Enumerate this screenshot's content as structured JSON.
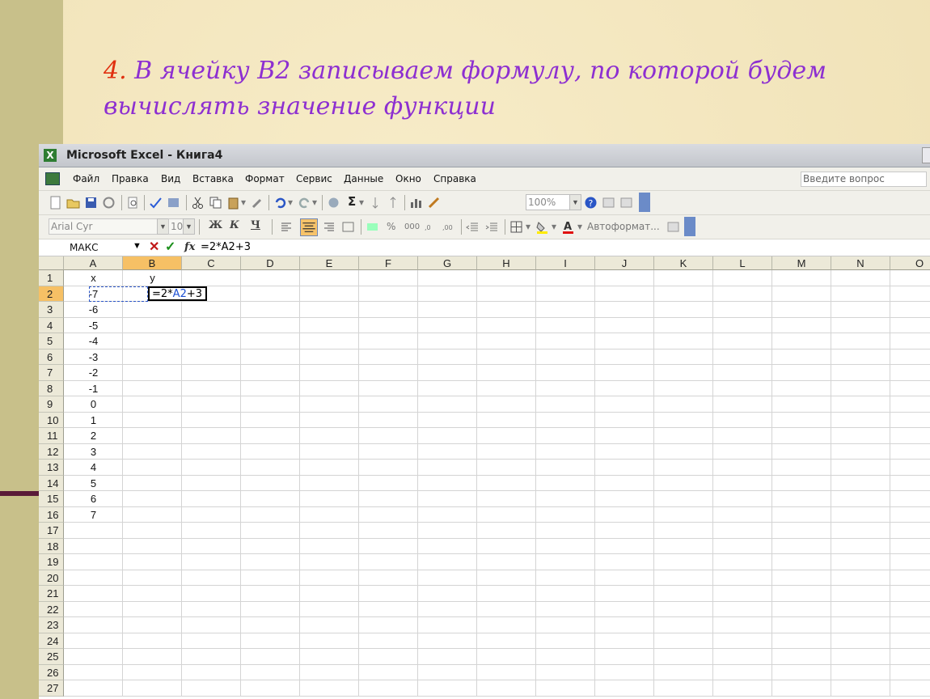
{
  "slide": {
    "step_number": "4.",
    "heading_text": "В ячейку В2 записываем формулу, по которой будем вычислять значение функции"
  },
  "window": {
    "title": "Microsoft Excel - Книга4",
    "icon": "excel-icon"
  },
  "menu": {
    "items": [
      "Файл",
      "Правка",
      "Вид",
      "Вставка",
      "Формат",
      "Сервис",
      "Данные",
      "Окно",
      "Справка"
    ],
    "ask_placeholder": "Введите вопрос"
  },
  "toolbar_standard": {
    "zoom_value": "100%",
    "sigma_label": "Σ"
  },
  "toolbar_format": {
    "font_name": "Arial Cyr",
    "font_size": "10",
    "bold_label": "Ж",
    "italic_label": "К",
    "underline_label": "Ч",
    "percent_label": "%",
    "thousands_label": "000",
    "autoformat_label": "Автоформат..."
  },
  "formula_bar": {
    "name_box": "МАКС",
    "cancel_symbol": "✕",
    "enter_symbol": "✓",
    "fx_label": "fx",
    "formula": "=2*A2+3"
  },
  "sheet": {
    "columns": [
      "A",
      "B",
      "C",
      "D",
      "E",
      "F",
      "G",
      "H",
      "I",
      "J",
      "K",
      "L",
      "M",
      "N",
      "O"
    ],
    "active_column": "B",
    "row_numbers": [
      "1",
      "2",
      "3",
      "4",
      "5",
      "6",
      "7",
      "8",
      "9",
      "10",
      "11",
      "12",
      "13",
      "14",
      "15",
      "16",
      "17",
      "18",
      "19",
      "20",
      "21",
      "22",
      "23",
      "24",
      "25",
      "26",
      "27"
    ],
    "active_row": "2",
    "header_x": "x",
    "header_y": "y",
    "x_values": [
      "-7",
      "-6",
      "-5",
      "-4",
      "-3",
      "-2",
      "-1",
      "0",
      "1",
      "2",
      "3",
      "4",
      "5",
      "6",
      "7"
    ],
    "editing_cell": {
      "prefix": "=2*",
      "ref": "A2",
      "suffix": "+3"
    }
  },
  "colors": {
    "heading": "#8d2fd1",
    "step_number": "#e03010",
    "active_header": "#f6c065",
    "reference_blue": "#1b4fd3"
  }
}
